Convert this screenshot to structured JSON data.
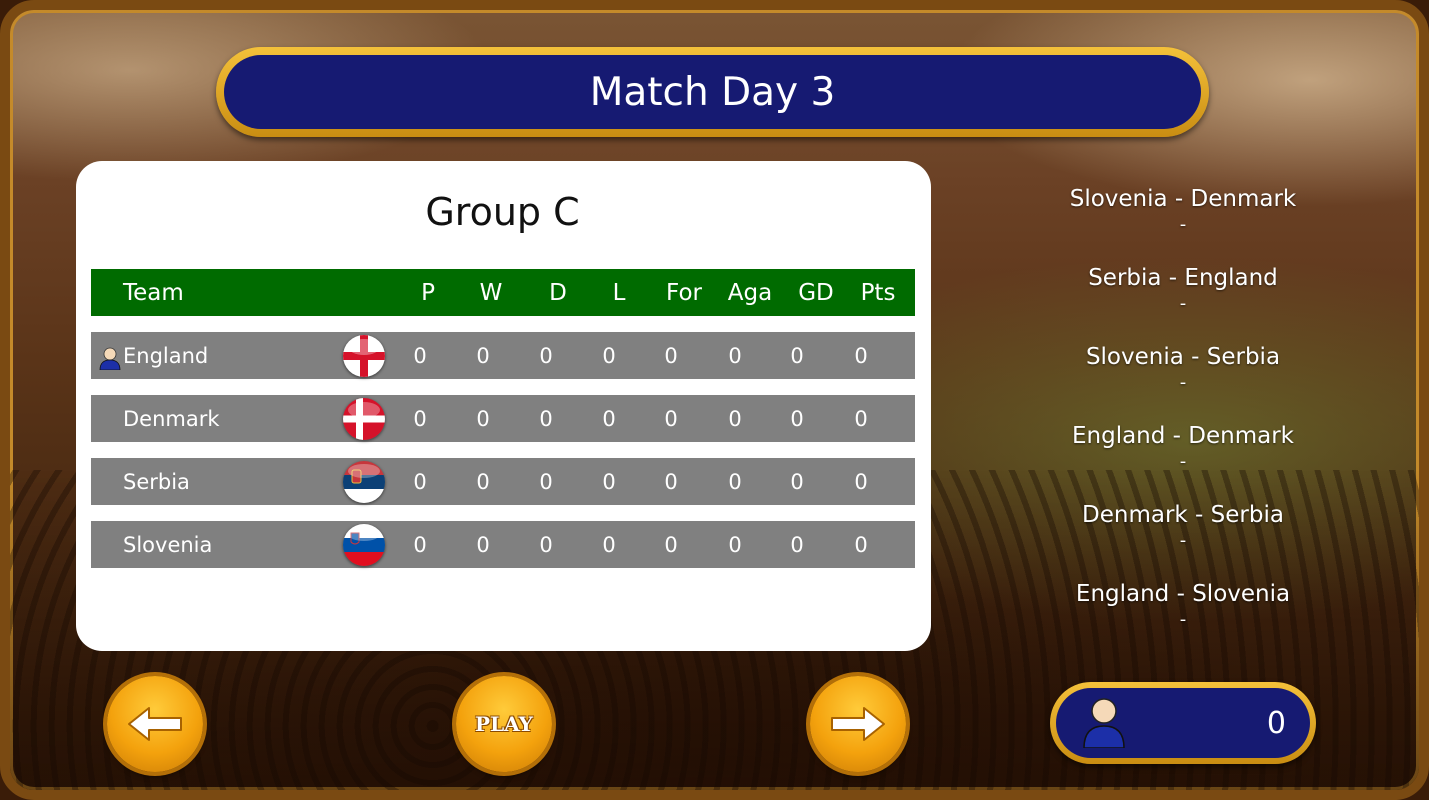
{
  "header": {
    "title": "Match Day 3"
  },
  "group": {
    "title": "Group C",
    "columns": [
      "Team",
      "P",
      "W",
      "D",
      "L",
      "For",
      "Aga",
      "GD",
      "Pts"
    ],
    "rows": [
      {
        "team": "England",
        "flag": "england-flag",
        "is_user": true,
        "stats": [
          "0",
          "0",
          "0",
          "0",
          "0",
          "0",
          "0",
          "0"
        ]
      },
      {
        "team": "Denmark",
        "flag": "denmark-flag",
        "is_user": false,
        "stats": [
          "0",
          "0",
          "0",
          "0",
          "0",
          "0",
          "0",
          "0"
        ]
      },
      {
        "team": "Serbia",
        "flag": "serbia-flag",
        "is_user": false,
        "stats": [
          "0",
          "0",
          "0",
          "0",
          "0",
          "0",
          "0",
          "0"
        ]
      },
      {
        "team": "Slovenia",
        "flag": "slovenia-flag",
        "is_user": false,
        "stats": [
          "0",
          "0",
          "0",
          "0",
          "0",
          "0",
          "0",
          "0"
        ]
      }
    ]
  },
  "fixtures": [
    {
      "match": "Slovenia - Denmark",
      "score": "-"
    },
    {
      "match": "Serbia - England",
      "score": "-"
    },
    {
      "match": "Slovenia - Serbia",
      "score": "-"
    },
    {
      "match": "England - Denmark",
      "score": "-"
    },
    {
      "match": "Denmark - Serbia",
      "score": "-"
    },
    {
      "match": "England - Slovenia",
      "score": "-"
    }
  ],
  "controls": {
    "prev_icon": "arrow-left-icon",
    "play_label": "PLAY",
    "next_icon": "arrow-right-icon"
  },
  "player": {
    "icon": "user-icon",
    "score": "0"
  },
  "colors": {
    "header_bg": "#161a72",
    "gold": "#f4c13a",
    "table_header": "#006b00",
    "row_bg": "#808080"
  }
}
